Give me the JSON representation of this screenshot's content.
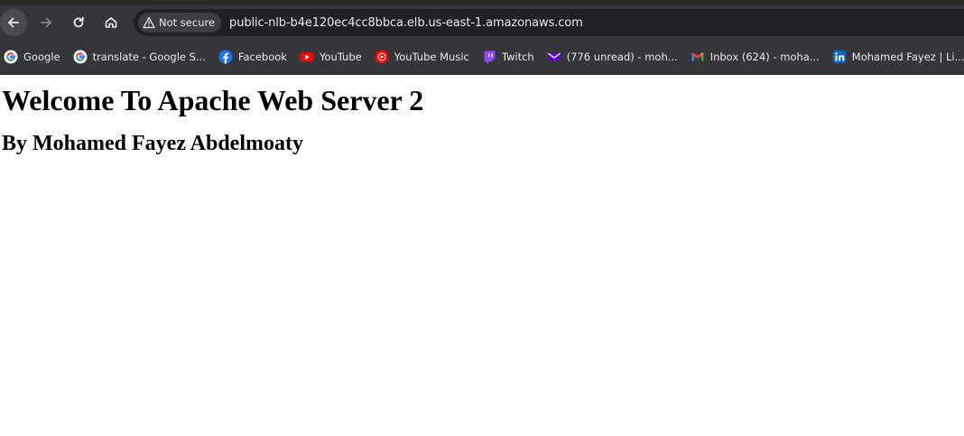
{
  "browser": {
    "nav": {
      "back_icon": "arrow-left-icon",
      "forward_icon": "arrow-right-icon",
      "reload_icon": "reload-icon",
      "home_icon": "home-icon"
    },
    "address_bar": {
      "security_label": "Not secure",
      "security_icon": "warning-triangle-icon",
      "url": "public-nlb-b4e120ec4cc8bbca.elb.us-east-1.amazonaws.com"
    },
    "bookmarks": [
      {
        "label": "Google",
        "icon": "google-icon"
      },
      {
        "label": "translate - Google S...",
        "icon": "google-icon"
      },
      {
        "label": "Facebook",
        "icon": "facebook-icon"
      },
      {
        "label": "YouTube",
        "icon": "youtube-icon"
      },
      {
        "label": "YouTube Music",
        "icon": "youtube-music-icon"
      },
      {
        "label": "Twitch",
        "icon": "twitch-icon"
      },
      {
        "label": "(776 unread) - moh...",
        "icon": "yahoo-mail-icon"
      },
      {
        "label": "Inbox (624) - moha...",
        "icon": "gmail-icon"
      },
      {
        "label": "Mohamed Fayez | Li...",
        "icon": "linkedin-icon"
      }
    ],
    "colors": {
      "toolbar": "#35363a",
      "omnibox": "#202124",
      "text": "#e8eaed"
    }
  },
  "page": {
    "heading": "Welcome To Apache Web Server 2",
    "subheading": "By Mohamed Fayez Abdelmoaty"
  }
}
